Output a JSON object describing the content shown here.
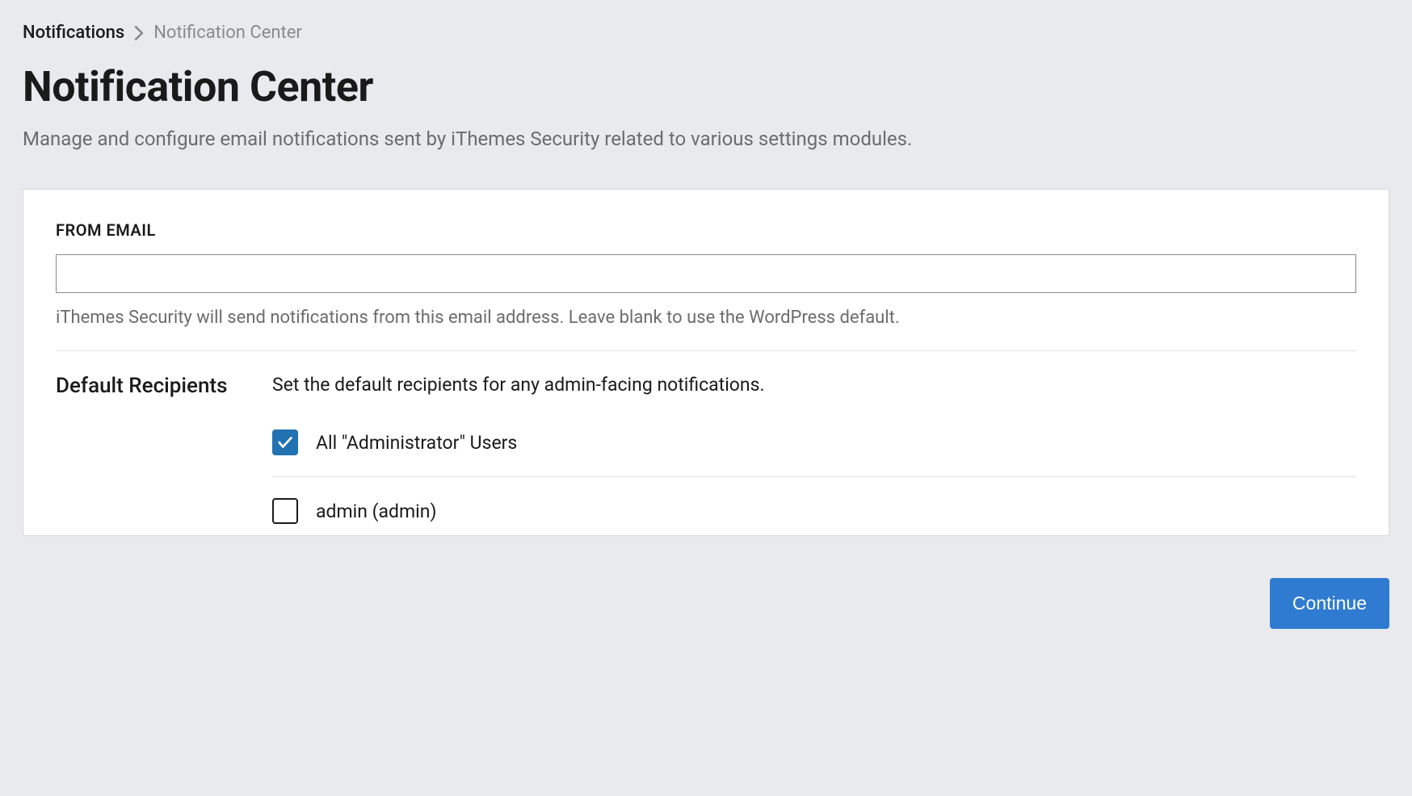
{
  "breadcrumb": {
    "parent": "Notifications",
    "current": "Notification Center"
  },
  "page": {
    "title": "Notification Center",
    "description": "Manage and configure email notifications sent by iThemes Security related to various settings modules."
  },
  "from_email": {
    "label": "FROM EMAIL",
    "value": "",
    "help": "iThemes Security will send notifications from this email address. Leave blank to use the WordPress default."
  },
  "recipients": {
    "heading": "Default Recipients",
    "description": "Set the default recipients for any admin-facing notifications.",
    "options": [
      {
        "label": "All \"Administrator\" Users",
        "checked": true
      },
      {
        "label": "admin (admin)",
        "checked": false
      }
    ]
  },
  "actions": {
    "continue": "Continue"
  }
}
